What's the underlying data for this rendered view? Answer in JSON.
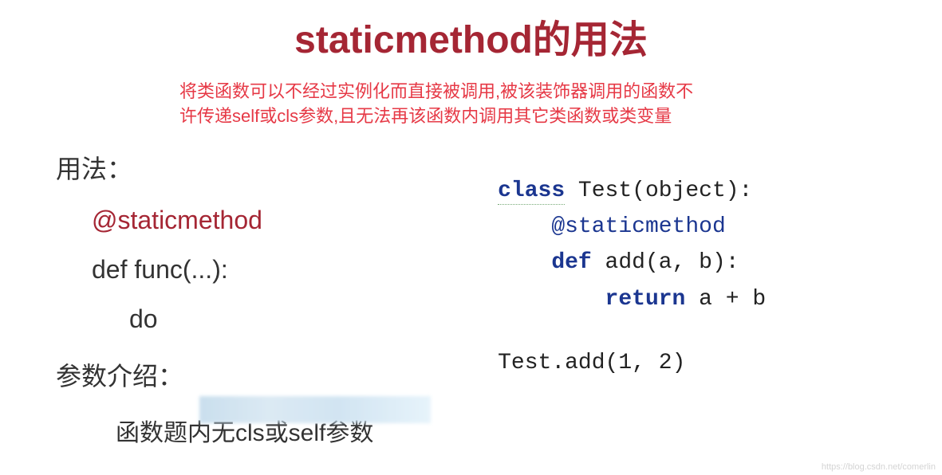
{
  "title": "staticmethod的用法",
  "description": {
    "line1": "将类函数可以不经过实例化而直接被调用,被该装饰器调用的函数不",
    "line2": "许传递self或cls参数,且无法再该函数内调用其它类函数或类变量"
  },
  "left": {
    "usage_label": "用法：",
    "decorator": "@staticmethod",
    "def_line": "def func(...):",
    "do_line": "do",
    "param_label": "参数介绍：",
    "param_desc": "函数题内无cls或self参数"
  },
  "code": {
    "kw_class": "class",
    "class_name": " Test(object):",
    "decorator": "@staticmethod",
    "kw_def": "def",
    "def_rest": " add(a, b):",
    "kw_return": "return",
    "return_rest": " a + b",
    "call_prefix": "Test.add(",
    "arg1": "1",
    "sep": ", ",
    "arg2": "2",
    "call_suffix": ")"
  },
  "watermark": "https://blog.csdn.net/comerlin"
}
